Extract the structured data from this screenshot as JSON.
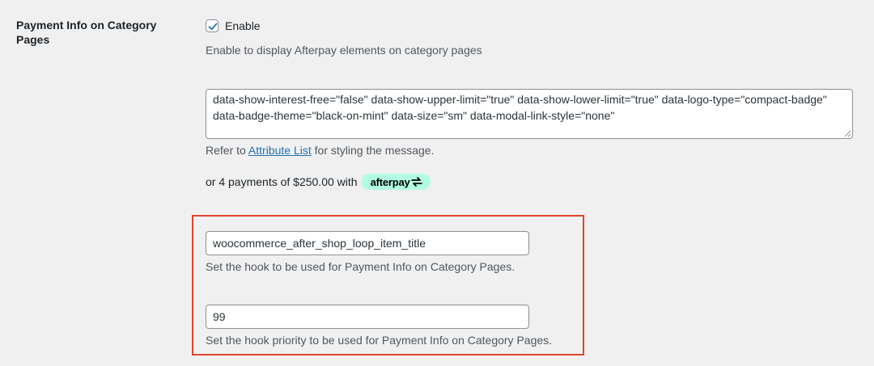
{
  "setting": {
    "label": "Payment Info on Category Pages",
    "enable_checkbox": {
      "checked": true,
      "label": "Enable"
    },
    "enable_description": "Enable to display Afterpay elements on category pages",
    "attributes_value": "data-show-interest-free=\"false\" data-show-upper-limit=\"true\" data-show-lower-limit=\"true\" data-logo-type=\"compact-badge\" data-badge-theme=\"black-on-mint\" data-size=\"sm\" data-modal-link-style=\"none\"",
    "attributes_help": {
      "prefix": "Refer to ",
      "link_text": "Attribute List",
      "suffix": " for styling the message."
    },
    "preview": {
      "text": "or 4 payments of $250.00 with",
      "badge_text": "afterpay",
      "badge_color": "#b2fce4"
    },
    "hook": {
      "value": "woocommerce_after_shop_loop_item_title",
      "description": "Set the hook to be used for Payment Info on Category Pages."
    },
    "priority": {
      "value": "99",
      "description": "Set the hook priority to be used for Payment Info on Category Pages."
    }
  },
  "colors": {
    "background": "#f0f0f1",
    "link": "#2271b1",
    "highlight": "#e0442d",
    "checkmark": "#2271b1"
  }
}
